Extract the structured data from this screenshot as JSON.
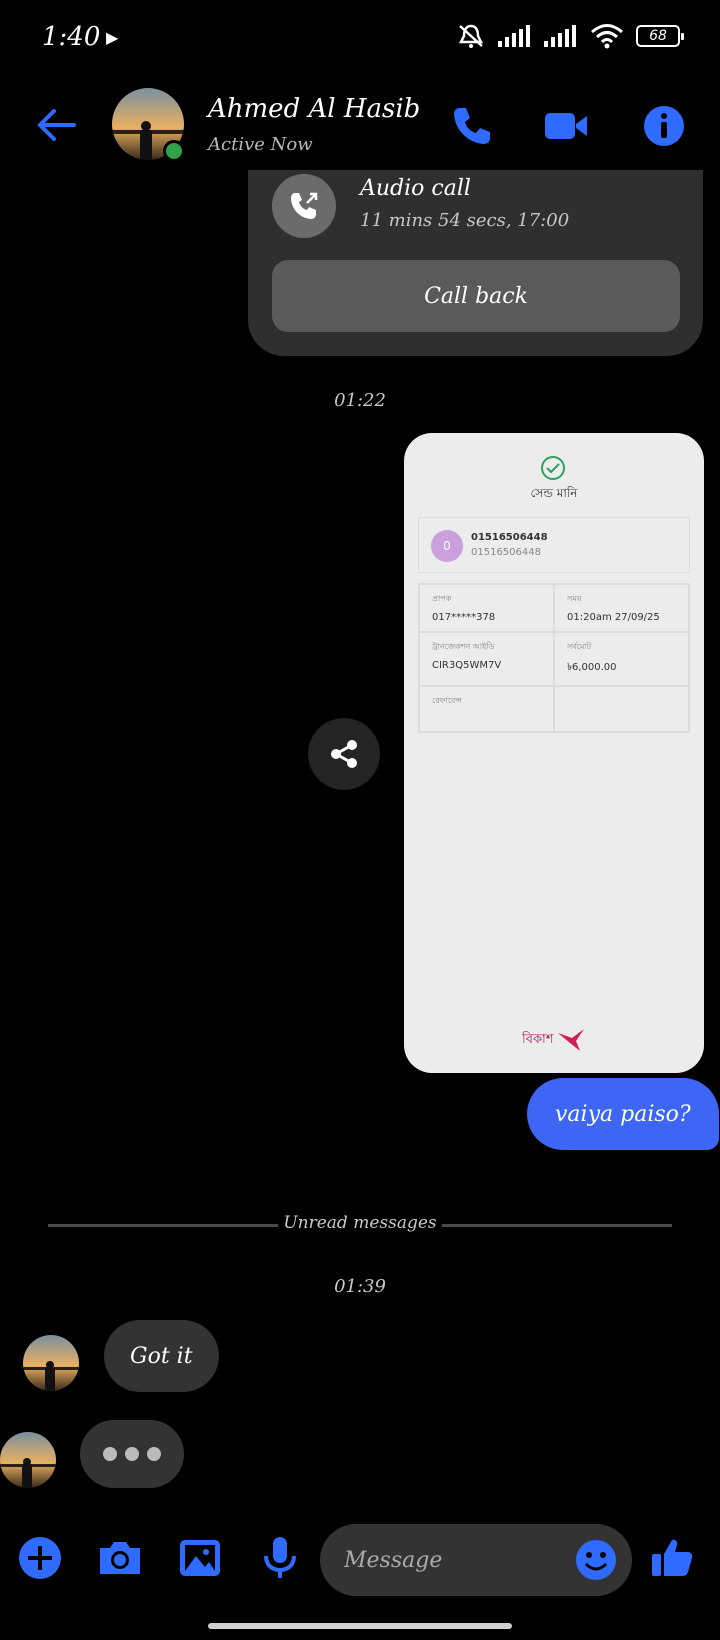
{
  "status_bar": {
    "time": "1:40",
    "battery": "68"
  },
  "header": {
    "name": "Ahmed Al Hasib",
    "status": "Active Now"
  },
  "call_card": {
    "title": "Audio call",
    "subtitle": "11 mins 54 secs, 17:00",
    "button": "Call back"
  },
  "timestamps": {
    "first": "01:22",
    "second": "01:39"
  },
  "receipt": {
    "title": "সেন্ড মানি",
    "avatar_initial": "0",
    "number_primary": "01516506448",
    "number_secondary": "01516506448",
    "fields": [
      {
        "label": "প্রাপক",
        "value": "017*****378"
      },
      {
        "label": "সময়",
        "value": "01:20am 27/09/25"
      },
      {
        "label": "ট্রানজেকশন আইডি",
        "value": "CIR3Q5WM7V"
      },
      {
        "label": "সর্বমোট",
        "value": "৳6,000.00"
      },
      {
        "label": "রেফারেন্স",
        "value": ""
      },
      {
        "label": "",
        "value": ""
      }
    ],
    "brand": "বিকাশ"
  },
  "messages": {
    "mine": "vaiya paiso?",
    "divider": "Unread messages",
    "theirs": "Got it"
  },
  "composer": {
    "placeholder": "Message"
  },
  "colors": {
    "accent": "#3d66f5",
    "icon_blue": "#2f6bff",
    "online": "#31a24c",
    "bkash": "#b0195e"
  }
}
